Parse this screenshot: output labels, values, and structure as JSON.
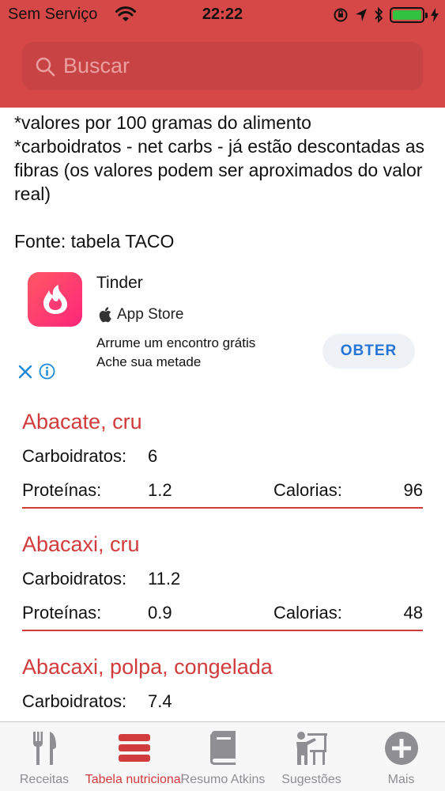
{
  "status_bar": {
    "carrier": "Sem Serviço",
    "time": "22:22"
  },
  "search": {
    "placeholder": "Buscar"
  },
  "info": {
    "lines": [
      "*valores por 100 gramas do alimento",
      "*carboidratos - net carbs - já estão descontadas as fibras (os valores podem ser aproximados do valor real)"
    ],
    "source": "Fonte: tabela TACO"
  },
  "ad": {
    "app_name": "Tinder",
    "store": "App Store",
    "line1": "Arrume um encontro grátis",
    "line2": "Ache sua metade",
    "cta": "OBTER"
  },
  "foods": [
    {
      "name": "Abacate, cru",
      "carbs_label": "Carboidratos:",
      "carbs": "6",
      "protein_label": "Proteínas:",
      "protein": "1.2",
      "calories_label": "Calorias:",
      "calories": "96"
    },
    {
      "name": "Abacaxi, cru",
      "carbs_label": "Carboidratos:",
      "carbs": "11.2",
      "protein_label": "Proteínas:",
      "protein": "0.9",
      "calories_label": "Calorias:",
      "calories": "48"
    },
    {
      "name": "Abacaxi, polpa, congelada",
      "carbs_label": "Carboidratos:",
      "carbs": "7.4"
    }
  ],
  "tabs": [
    {
      "label": "Receitas",
      "icon": "fork-knife-icon",
      "active": false
    },
    {
      "label": "Tabela nutricional",
      "icon": "list-bars-icon",
      "active": true
    },
    {
      "label": "Resumo Atkins",
      "icon": "book-icon",
      "active": false
    },
    {
      "label": "Sugestões",
      "icon": "presenter-icon",
      "active": false
    },
    {
      "label": "Mais",
      "icon": "plus-circle-icon",
      "active": false
    }
  ],
  "colors": {
    "header": "#d64848",
    "accent": "#d23b3b",
    "tab_inactive": "#8e8e93",
    "cta": "#2574d6"
  }
}
